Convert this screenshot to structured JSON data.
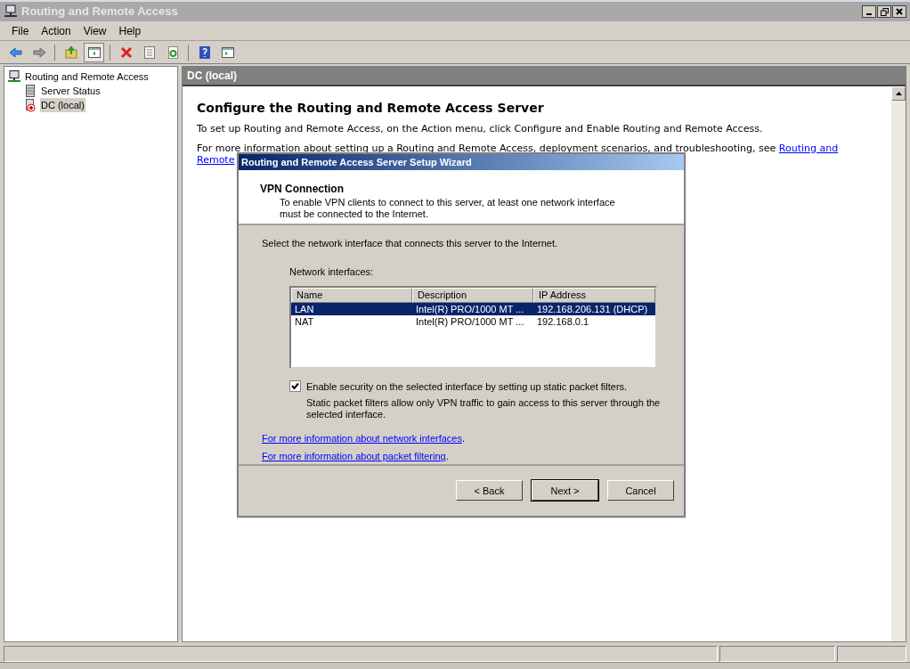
{
  "window": {
    "title": "Routing and Remote Access"
  },
  "menu": [
    "File",
    "Action",
    "View",
    "Help"
  ],
  "toolbar": [
    {
      "kind": "back"
    },
    {
      "kind": "forward"
    },
    {
      "kind": "sep"
    },
    {
      "kind": "up"
    },
    {
      "kind": "pane",
      "selected": true
    },
    {
      "kind": "sep"
    },
    {
      "kind": "delete"
    },
    {
      "kind": "properties"
    },
    {
      "kind": "refresh"
    },
    {
      "kind": "sep"
    },
    {
      "kind": "help"
    },
    {
      "kind": "action-pane"
    }
  ],
  "tree": [
    {
      "label": "Routing and Remote Access",
      "kind": "root",
      "selected": false,
      "children": [
        {
          "label": "Server Status",
          "kind": "status",
          "selected": false
        },
        {
          "label": "DC (local)",
          "kind": "server",
          "selected": true
        }
      ]
    }
  ],
  "pane": {
    "header": "DC (local)",
    "heading": "Configure the Routing and Remote Access Server",
    "intro": "To set up Routing and Remote Access, on the Action menu, click Configure and Enable Routing and Remote Access.",
    "more_text": "For more information about setting up a Routing and Remote Access, deployment scenarios, and troubleshooting, see",
    "more_link_1": "Routing and",
    "more_link_2": "Remote"
  },
  "wizard": {
    "title": "Routing and Remote Access Server Setup Wizard",
    "page_title": "VPN Connection",
    "page_subtitle": "To enable VPN clients to connect to this server, at least one network interface must be connected to the Internet.",
    "instruction": "Select the network interface that connects this server to the Internet.",
    "list_label": "Network interfaces:",
    "columns": [
      "Name",
      "Description",
      "IP Address"
    ],
    "rows": [
      {
        "cells": [
          "LAN",
          "Intel(R) PRO/1000 MT ...",
          "192.168.206.131 (DHCP)"
        ],
        "selected": true
      },
      {
        "cells": [
          "NAT",
          "Intel(R) PRO/1000 MT ...",
          "192.168.0.1"
        ],
        "selected": false
      }
    ],
    "checkbox": {
      "label": "Enable security on the selected interface by setting up static packet filters.",
      "checked": true,
      "note": "Static packet filters allow only VPN traffic to gain access to this server through the selected interface."
    },
    "links": [
      {
        "text": "For more information about network interfaces",
        "suffix": "."
      },
      {
        "text": "For more information about packet filtering",
        "suffix": "."
      }
    ],
    "buttons": [
      {
        "label": "< Back",
        "default": false
      },
      {
        "label": "Next >",
        "default": true
      },
      {
        "label": "Cancel",
        "default": false
      }
    ]
  }
}
